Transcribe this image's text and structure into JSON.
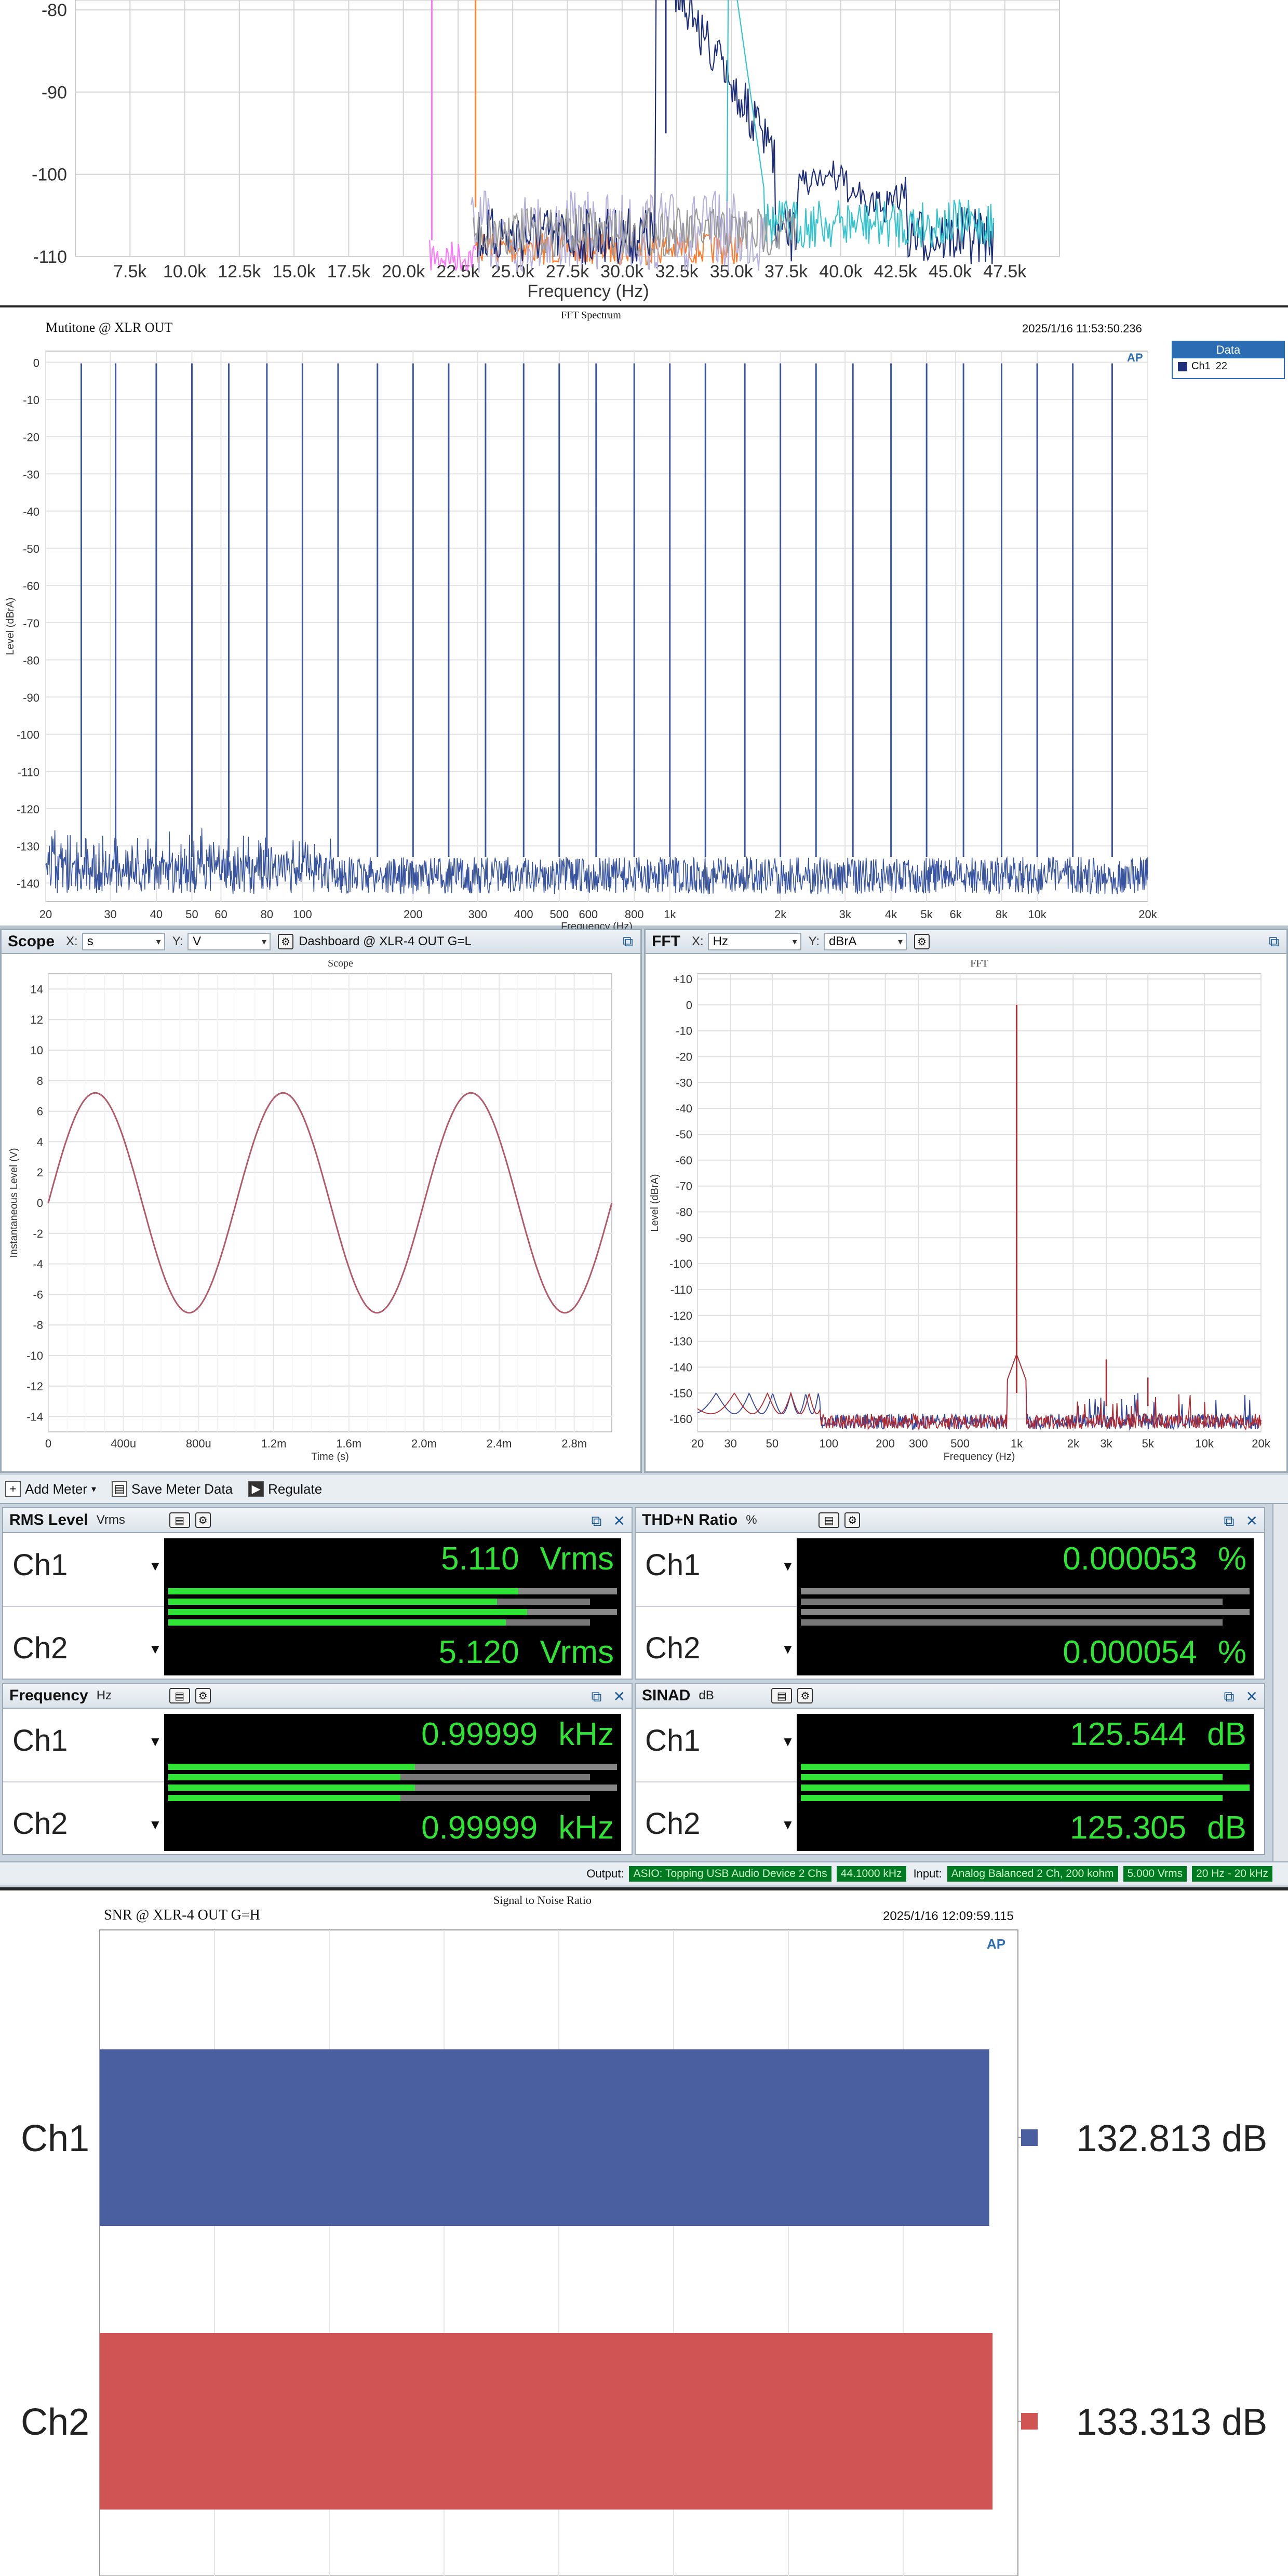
{
  "top_fft": {
    "y_ticks": [
      "-80",
      "-90",
      "-100",
      "-110"
    ],
    "x_ticks": [
      "7.5k",
      "10.0k",
      "12.5k",
      "15.0k",
      "17.5k",
      "20.0k",
      "22.5k",
      "25.0k",
      "27.5k",
      "30.0k",
      "32.5k",
      "35.0k",
      "37.5k",
      "40.0k",
      "42.5k",
      "45.0k",
      "47.5k"
    ],
    "xlabel": "Frequency (Hz)",
    "series_colors": [
      "#ff77ff",
      "#ff7a2a",
      "#b6b2dc",
      "#1f2f7a",
      "#38c4cc",
      "#9a9a9a"
    ]
  },
  "multitone": {
    "left_title": "Mutitone @ XLR OUT",
    "center_title": "FFT Spectrum",
    "timestamp": "2025/1/16 11:53:50.236",
    "legend_title": "Data",
    "legend_item": "Ch1",
    "legend_sub": "22",
    "ylabel": "Level (dBrA)",
    "xlabel": "Frequency (Hz)",
    "y_ticks": [
      "0",
      "-10",
      "-20",
      "-30",
      "-40",
      "-50",
      "-60",
      "-70",
      "-80",
      "-90",
      "-100",
      "-110",
      "-120",
      "-130",
      "-140"
    ],
    "x_ticks": [
      "20",
      "30",
      "40",
      "50",
      "60",
      "80",
      "100",
      "200",
      "300",
      "400",
      "500",
      "600",
      "800",
      "1k",
      "2k",
      "3k",
      "4k",
      "5k",
      "6k",
      "8k",
      "10k",
      "20k"
    ],
    "color": "#3a55a0"
  },
  "scope": {
    "title": "Scope",
    "x_label": "X:",
    "x_unit": "s",
    "y_label": "Y:",
    "y_unit": "V",
    "source": "Dashboard @ XLR-4 OUT G=L",
    "chart_title": "Scope",
    "ylabel": "Instantaneous Level (V)",
    "xlabel": "Time (s)",
    "y_ticks": [
      "14",
      "12",
      "10",
      "8",
      "6",
      "4",
      "2",
      "0",
      "-2",
      "-4",
      "-6",
      "-8",
      "-10",
      "-12",
      "-14"
    ],
    "x_ticks": [
      "0",
      "400u",
      "800u",
      "1.2m",
      "1.6m",
      "2.0m",
      "2.4m",
      "2.8m"
    ],
    "color": "#b05a6a"
  },
  "fft": {
    "title": "FFT",
    "x_label": "X:",
    "x_unit": "Hz",
    "y_label": "Y:",
    "y_unit": "dBrA",
    "chart_title": "FFT",
    "ylabel": "Level (dBrA)",
    "xlabel": "Frequency (Hz)",
    "y_ticks": [
      "+10",
      "0",
      "-10",
      "-20",
      "-30",
      "-40",
      "-50",
      "-60",
      "-70",
      "-80",
      "-90",
      "-100",
      "-110",
      "-120",
      "-130",
      "-140",
      "-150",
      "-160"
    ],
    "x_ticks": [
      "20",
      "30",
      "50",
      "100",
      "200",
      "300",
      "500",
      "1k",
      "2k",
      "3k",
      "5k",
      "10k",
      "20k"
    ],
    "colors": [
      "#b02a30",
      "#34449a"
    ]
  },
  "toolbar": {
    "add_meter": "Add Meter",
    "save_meter": "Save Meter Data",
    "regulate": "Regulate"
  },
  "meters": {
    "rms": {
      "title": "RMS Level",
      "unit": "Vrms",
      "ch1": "5.110",
      "ch2": "5.120",
      "ch1_unit": "Vrms",
      "ch2_unit": "Vrms"
    },
    "thd": {
      "title": "THD+N Ratio",
      "unit": "%",
      "ch1": "0.000053",
      "ch2": "0.000054",
      "ch1_unit": "%",
      "ch2_unit": "%"
    },
    "freq": {
      "title": "Frequency",
      "unit": "Hz",
      "ch1": "0.99999",
      "ch2": "0.99999",
      "ch1_unit": "kHz",
      "ch2_unit": "kHz"
    },
    "sinad": {
      "title": "SINAD",
      "unit": "dB",
      "ch1": "125.544",
      "ch2": "125.305",
      "ch1_unit": "dB",
      "ch2_unit": "dB"
    },
    "ch1_label": "Ch1",
    "ch2_label": "Ch2"
  },
  "status": {
    "output_label": "Output:",
    "output_device": "ASIO: Topping USB Audio Device 2 Chs",
    "output_rate": "44.1000 kHz",
    "input_label": "Input:",
    "input_device": "Analog Balanced 2 Ch, 200 kohm",
    "input_range": "5.000 Vrms",
    "input_bw": "20 Hz - 20 kHz"
  },
  "snr": {
    "left_title": "SNR @ XLR-4 OUT G=H",
    "center_title": "Signal to Noise Ratio",
    "timestamp": "2025/1/16 12:09:59.115"
  },
  "chart_data": [
    {
      "type": "line",
      "title": "",
      "xlabel": "Frequency (Hz)",
      "ylabel": "",
      "xlim": [
        5000,
        50000
      ],
      "ylim": [
        -110,
        -75
      ],
      "series": [
        {
          "x": [
            22500,
            25000,
            27500,
            30000,
            32500,
            35000,
            37500,
            40000,
            42500,
            45000,
            47500
          ],
          "y": [
            -105,
            -103,
            -100,
            -101,
            -99,
            -92,
            -99,
            -101,
            -100,
            -103,
            -106
          ]
        }
      ]
    },
    {
      "type": "line",
      "title": "FFT Spectrum",
      "xlabel": "Frequency (Hz)",
      "ylabel": "Level (dBrA)",
      "xlim": [
        20,
        20000
      ],
      "ylim": [
        -145,
        3
      ],
      "xscale": "log",
      "tones": [
        25,
        31,
        40,
        50,
        63,
        80,
        100,
        125,
        160,
        200,
        250,
        315,
        400,
        500,
        630,
        800,
        1000,
        1250,
        1600,
        2000,
        2500,
        3150,
        4000,
        5000,
        6300,
        8000,
        10000,
        12500,
        16000
      ],
      "tone_level": -0.3,
      "noise_floor": -133,
      "series": [
        {
          "name": "Ch1",
          "color": "#3a55a0"
        }
      ]
    },
    {
      "type": "line",
      "title": "Scope",
      "xlabel": "Time (s)",
      "ylabel": "Instantaneous Level (V)",
      "xlim": [
        0,
        0.003
      ],
      "ylim": [
        -15,
        15
      ],
      "amplitude": 7.2,
      "frequency_hz": 1000,
      "series": [
        {
          "color": "#b05a6a"
        }
      ]
    },
    {
      "type": "line",
      "title": "FFT",
      "xlabel": "Frequency (Hz)",
      "ylabel": "Level (dBrA)",
      "xlim": [
        20,
        20000
      ],
      "ylim": [
        -165,
        12
      ],
      "xscale": "log",
      "fundamental_hz": 1000,
      "fundamental_db": 0,
      "noise_floor": -158,
      "spurs": [
        {
          "x": 3000,
          "y": -137
        },
        {
          "x": 5000,
          "y": -144
        }
      ],
      "series": [
        {
          "color": "#b02a30"
        },
        {
          "color": "#34449a"
        }
      ]
    },
    {
      "type": "bar",
      "title": "Signal to Noise Ratio",
      "orientation": "horizontal",
      "categories": [
        "Ch1",
        "Ch2"
      ],
      "values": [
        132.813,
        133.313
      ],
      "value_labels": [
        "132.813 dB",
        "133.313 dB"
      ],
      "colors": [
        "#4a5fa0",
        "#d05454"
      ]
    }
  ]
}
